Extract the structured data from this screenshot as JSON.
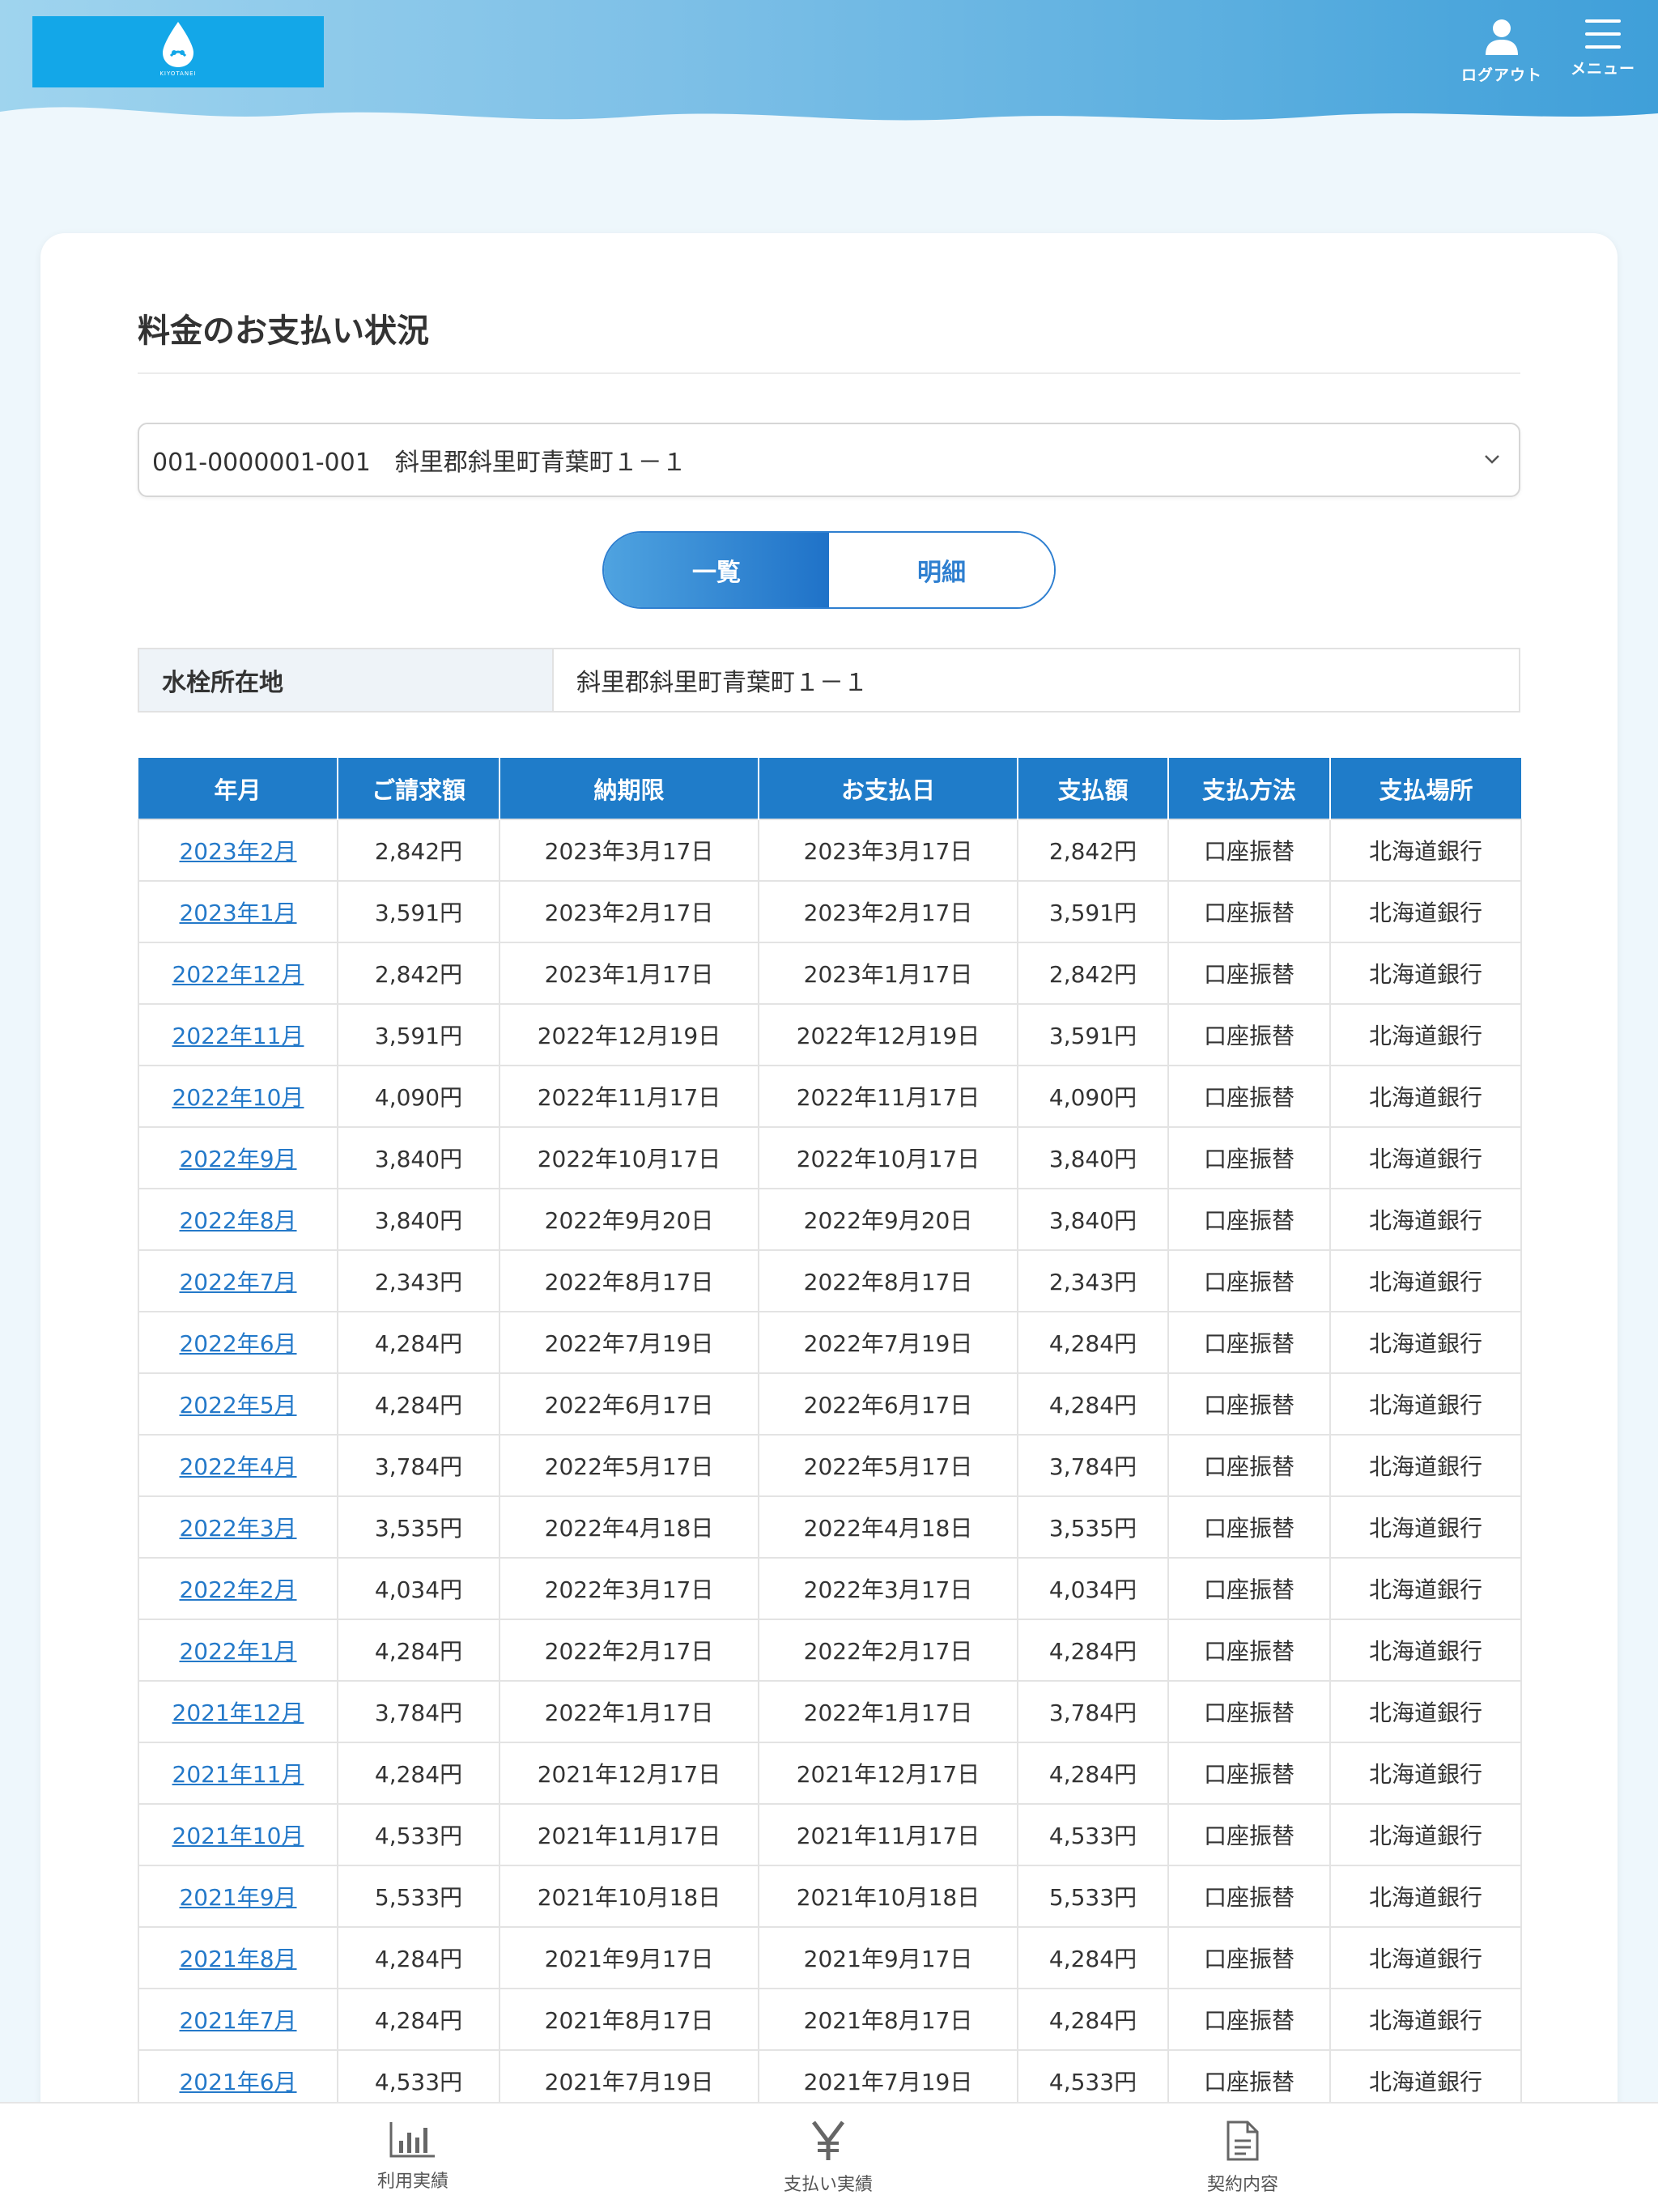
{
  "header": {
    "logo_text": "KIYOTANEI",
    "logout_label": "ログアウト",
    "menu_label": "メニュー"
  },
  "page": {
    "title": "料金のお支払い状況"
  },
  "account_select": {
    "value": "001-0000001-001　斜里郡斜里町青葉町１－１"
  },
  "view_toggle": {
    "list_label": "一覧",
    "detail_label": "明細",
    "active": "list"
  },
  "location": {
    "label": "水栓所在地",
    "value": "斜里郡斜里町青葉町１－１"
  },
  "table": {
    "headers": [
      "年月",
      "ご請求額",
      "納期限",
      "お支払日",
      "支払額",
      "支払方法",
      "支払場所"
    ],
    "rows": [
      [
        "2023年2月",
        "2,842円",
        "2023年3月17日",
        "2023年3月17日",
        "2,842円",
        "口座振替",
        "北海道銀行"
      ],
      [
        "2023年1月",
        "3,591円",
        "2023年2月17日",
        "2023年2月17日",
        "3,591円",
        "口座振替",
        "北海道銀行"
      ],
      [
        "2022年12月",
        "2,842円",
        "2023年1月17日",
        "2023年1月17日",
        "2,842円",
        "口座振替",
        "北海道銀行"
      ],
      [
        "2022年11月",
        "3,591円",
        "2022年12月19日",
        "2022年12月19日",
        "3,591円",
        "口座振替",
        "北海道銀行"
      ],
      [
        "2022年10月",
        "4,090円",
        "2022年11月17日",
        "2022年11月17日",
        "4,090円",
        "口座振替",
        "北海道銀行"
      ],
      [
        "2022年9月",
        "3,840円",
        "2022年10月17日",
        "2022年10月17日",
        "3,840円",
        "口座振替",
        "北海道銀行"
      ],
      [
        "2022年8月",
        "3,840円",
        "2022年9月20日",
        "2022年9月20日",
        "3,840円",
        "口座振替",
        "北海道銀行"
      ],
      [
        "2022年7月",
        "2,343円",
        "2022年8月17日",
        "2022年8月17日",
        "2,343円",
        "口座振替",
        "北海道銀行"
      ],
      [
        "2022年6月",
        "4,284円",
        "2022年7月19日",
        "2022年7月19日",
        "4,284円",
        "口座振替",
        "北海道銀行"
      ],
      [
        "2022年5月",
        "4,284円",
        "2022年6月17日",
        "2022年6月17日",
        "4,284円",
        "口座振替",
        "北海道銀行"
      ],
      [
        "2022年4月",
        "3,784円",
        "2022年5月17日",
        "2022年5月17日",
        "3,784円",
        "口座振替",
        "北海道銀行"
      ],
      [
        "2022年3月",
        "3,535円",
        "2022年4月18日",
        "2022年4月18日",
        "3,535円",
        "口座振替",
        "北海道銀行"
      ],
      [
        "2022年2月",
        "4,034円",
        "2022年3月17日",
        "2022年3月17日",
        "4,034円",
        "口座振替",
        "北海道銀行"
      ],
      [
        "2022年1月",
        "4,284円",
        "2022年2月17日",
        "2022年2月17日",
        "4,284円",
        "口座振替",
        "北海道銀行"
      ],
      [
        "2021年12月",
        "3,784円",
        "2022年1月17日",
        "2022年1月17日",
        "3,784円",
        "口座振替",
        "北海道銀行"
      ],
      [
        "2021年11月",
        "4,284円",
        "2021年12月17日",
        "2021年12月17日",
        "4,284円",
        "口座振替",
        "北海道銀行"
      ],
      [
        "2021年10月",
        "4,533円",
        "2021年11月17日",
        "2021年11月17日",
        "4,533円",
        "口座振替",
        "北海道銀行"
      ],
      [
        "2021年9月",
        "5,533円",
        "2021年10月18日",
        "2021年10月18日",
        "5,533円",
        "口座振替",
        "北海道銀行"
      ],
      [
        "2021年8月",
        "4,284円",
        "2021年9月17日",
        "2021年9月17日",
        "4,284円",
        "口座振替",
        "北海道銀行"
      ],
      [
        "2021年7月",
        "4,284円",
        "2021年8月17日",
        "2021年8月17日",
        "4,284円",
        "口座振替",
        "北海道銀行"
      ],
      [
        "2021年6月",
        "4,533円",
        "2021年7月19日",
        "2021年7月19日",
        "4,533円",
        "口座振替",
        "北海道銀行"
      ]
    ]
  },
  "bottom_nav": {
    "items": [
      {
        "label": "利用実績",
        "icon": "bar-chart-icon"
      },
      {
        "label": "支払い実績",
        "icon": "yen-icon"
      },
      {
        "label": "契約内容",
        "icon": "document-icon"
      }
    ]
  },
  "colors": {
    "accent": "#1f7cc9",
    "link": "#2479c9",
    "logo_bg": "#13a7e8"
  }
}
